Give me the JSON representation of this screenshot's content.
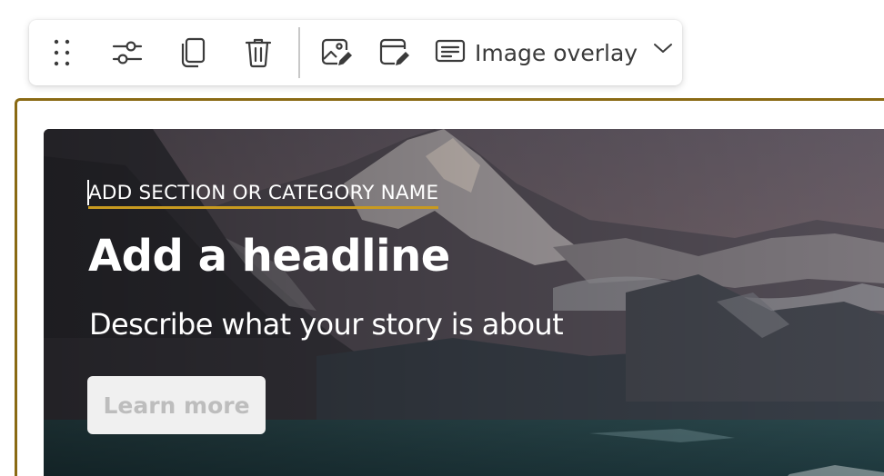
{
  "toolbar": {
    "icons": [
      "drag-handle-icon",
      "settings-sliders-icon",
      "duplicate-icon",
      "delete-icon",
      "edit-image-icon",
      "edit-background-icon",
      "text-layout-icon",
      "chevron-down-icon"
    ],
    "layout_select": {
      "value": "Image overlay"
    }
  },
  "hero": {
    "category": "ADD SECTION OR CATEGORY NAME",
    "headline": "Add a headline",
    "description": "Describe what your story is about",
    "cta_label": "Learn more"
  },
  "colors": {
    "selection_border": "#8a6a14",
    "category_underline": "#c89a20",
    "toolbar_icon": "#3b3b3b",
    "cta_background": "#f0f0f0",
    "cta_text": "#bdbdbd"
  }
}
